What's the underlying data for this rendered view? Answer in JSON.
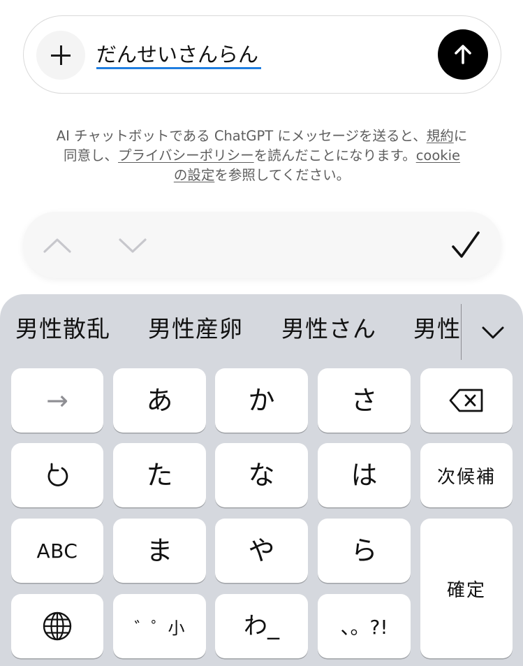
{
  "composer": {
    "input_text": "だんせいさんらん"
  },
  "disclaimer": {
    "text_1": "AI チャットボットである ChatGPT にメッセージを送ると、",
    "link_terms": "規約",
    "text_2": "に",
    "text_3": "同意し、",
    "link_privacy": "プライバシーポリシー",
    "text_4": "を読んだことになります。",
    "link_cookie_1": "cookie",
    "link_cookie_2": "の設定",
    "text_5": "を参照してください。"
  },
  "keyboard": {
    "candidates": [
      "男性散乱",
      "男性産卵",
      "男性さん",
      "男性"
    ],
    "keys": {
      "arrow": "→",
      "a": "あ",
      "ka": "か",
      "sa": "さ",
      "ta": "た",
      "na": "な",
      "ha": "は",
      "next_candidate": "次候補",
      "abc": "ABC",
      "ma": "ま",
      "ya": "や",
      "ra": "ら",
      "confirm": "確定",
      "dakuten": "゛゜小",
      "wa": "わ_",
      "punct": "、。?!"
    }
  }
}
